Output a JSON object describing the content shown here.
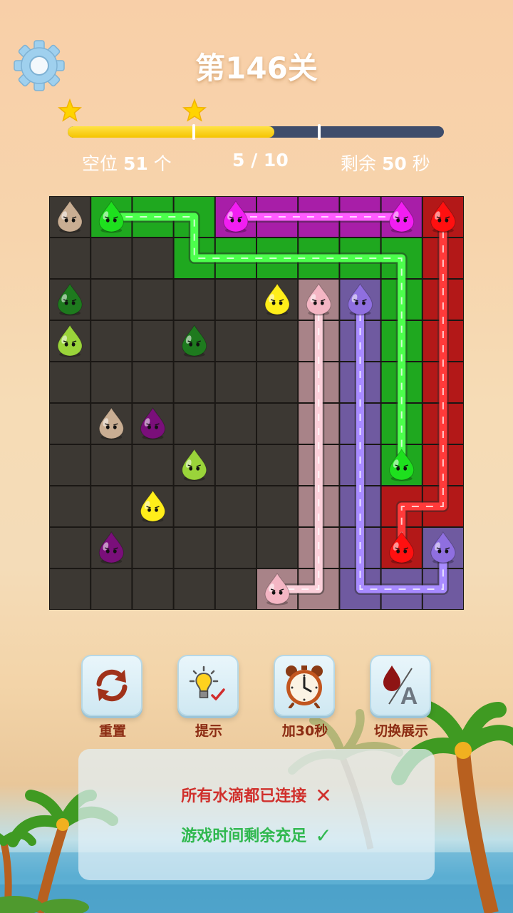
{
  "header": {
    "title": "第146关",
    "settings_icon": "gear-icon"
  },
  "progress": {
    "fraction": 0.55,
    "star_count": 2,
    "star_color": "#ffd400"
  },
  "stats": {
    "empty_label": "空位",
    "empty_value": "51",
    "empty_unit": "个",
    "moves": "5 / 10",
    "time_label": "剩余",
    "time_value": "50",
    "time_unit": "秒"
  },
  "board": {
    "cols": 10,
    "rows": 10,
    "empty_color": "#3c3833",
    "drops": [
      {
        "row": 0,
        "col": 0,
        "color": "tan"
      },
      {
        "row": 0,
        "col": 1,
        "color": "green"
      },
      {
        "row": 0,
        "col": 4,
        "color": "magenta"
      },
      {
        "row": 0,
        "col": 8,
        "color": "magenta"
      },
      {
        "row": 0,
        "col": 9,
        "color": "red"
      },
      {
        "row": 2,
        "col": 0,
        "color": "darkgreen"
      },
      {
        "row": 2,
        "col": 5,
        "color": "yellow"
      },
      {
        "row": 2,
        "col": 6,
        "color": "pink"
      },
      {
        "row": 2,
        "col": 7,
        "color": "lavender"
      },
      {
        "row": 3,
        "col": 0,
        "color": "lime"
      },
      {
        "row": 3,
        "col": 3,
        "color": "darkgreen"
      },
      {
        "row": 5,
        "col": 1,
        "color": "tan"
      },
      {
        "row": 5,
        "col": 2,
        "color": "purple"
      },
      {
        "row": 6,
        "col": 3,
        "color": "lime"
      },
      {
        "row": 6,
        "col": 8,
        "color": "green"
      },
      {
        "row": 7,
        "col": 2,
        "color": "yellow"
      },
      {
        "row": 8,
        "col": 1,
        "color": "purple"
      },
      {
        "row": 8,
        "col": 8,
        "color": "red"
      },
      {
        "row": 8,
        "col": 9,
        "color": "lavender"
      },
      {
        "row": 9,
        "col": 5,
        "color": "pink"
      }
    ],
    "paths": [
      {
        "color": "green",
        "cells": [
          [
            0,
            1
          ],
          [
            0,
            2
          ],
          [
            0,
            3
          ],
          [
            1,
            3
          ],
          [
            1,
            4
          ],
          [
            1,
            5
          ],
          [
            1,
            6
          ],
          [
            1,
            7
          ],
          [
            1,
            8
          ],
          [
            2,
            8
          ],
          [
            3,
            8
          ],
          [
            4,
            8
          ],
          [
            5,
            8
          ],
          [
            6,
            8
          ]
        ]
      },
      {
        "color": "magenta",
        "cells": [
          [
            0,
            4
          ],
          [
            0,
            5
          ],
          [
            0,
            6
          ],
          [
            0,
            7
          ],
          [
            0,
            8
          ]
        ]
      },
      {
        "color": "red",
        "cells": [
          [
            0,
            9
          ],
          [
            1,
            9
          ],
          [
            2,
            9
          ],
          [
            3,
            9
          ],
          [
            4,
            9
          ],
          [
            5,
            9
          ],
          [
            6,
            9
          ],
          [
            7,
            9
          ],
          [
            7,
            8
          ],
          [
            8,
            8
          ]
        ]
      },
      {
        "color": "pink",
        "cells": [
          [
            2,
            6
          ],
          [
            3,
            6
          ],
          [
            4,
            6
          ],
          [
            5,
            6
          ],
          [
            6,
            6
          ],
          [
            7,
            6
          ],
          [
            8,
            6
          ],
          [
            9,
            6
          ],
          [
            9,
            5
          ]
        ]
      },
      {
        "color": "lavender",
        "cells": [
          [
            2,
            7
          ],
          [
            3,
            7
          ],
          [
            4,
            7
          ],
          [
            5,
            7
          ],
          [
            6,
            7
          ],
          [
            7,
            7
          ],
          [
            8,
            7
          ],
          [
            9,
            7
          ],
          [
            9,
            8
          ],
          [
            9,
            9
          ],
          [
            8,
            9
          ]
        ]
      }
    ],
    "palette": {
      "tan": {
        "drop": "#c9ae93",
        "fill": "#c9ae93",
        "line": "#d9c3aa"
      },
      "green": {
        "drop": "#1ee01e",
        "fill": "#1fa81f",
        "line": "#4cff4c"
      },
      "magenta": {
        "drop": "#f21ef2",
        "fill": "#a81ea8",
        "line": "#ff5cff"
      },
      "red": {
        "drop": "#ff1010",
        "fill": "#b31818",
        "line": "#ff3a3a"
      },
      "darkgreen": {
        "drop": "#1e7a1e",
        "fill": "#1e7a1e",
        "line": "#2e9a2e"
      },
      "yellow": {
        "drop": "#ffee1a",
        "fill": "#ffee1a",
        "line": "#fff36a"
      },
      "pink": {
        "drop": "#f4b6c4",
        "fill": "#a88388",
        "line": "#fbd0da"
      },
      "lavender": {
        "drop": "#8f6fe0",
        "fill": "#6f5aa0",
        "line": "#a88bff"
      },
      "lime": {
        "drop": "#9ad43a",
        "fill": "#9ad43a",
        "line": "#b6ee5a"
      },
      "purple": {
        "drop": "#7a0f7a",
        "fill": "#7a0f7a",
        "line": "#9a2a9a"
      }
    }
  },
  "actions": [
    {
      "label": "重置",
      "icon": "refresh-icon"
    },
    {
      "label": "提示",
      "icon": "lightbulb-icon"
    },
    {
      "label": "加30秒",
      "icon": "alarm-clock-icon"
    },
    {
      "label": "切换展示",
      "icon": "drop-letter-icon"
    }
  ],
  "conditions": [
    {
      "text": "所有水滴都已连接",
      "mark": "✕",
      "color": "#d0302c"
    },
    {
      "text": "游戏时间剩余充足",
      "mark": "✓",
      "color": "#2fb84e"
    }
  ]
}
